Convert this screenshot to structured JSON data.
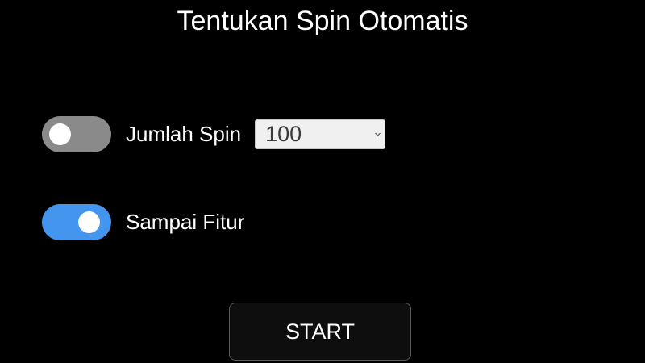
{
  "title": "Tentukan Spin Otomatis",
  "options": {
    "spin_count": {
      "label": "Jumlah Spin",
      "enabled": false,
      "selected_value": "100"
    },
    "until_feature": {
      "label": "Sampai Fitur",
      "enabled": true
    }
  },
  "start_button": {
    "label": "START"
  },
  "colors": {
    "background": "#000000",
    "toggle_on": "#4395ee",
    "toggle_off": "#8a8a8a",
    "text": "#ffffff"
  }
}
